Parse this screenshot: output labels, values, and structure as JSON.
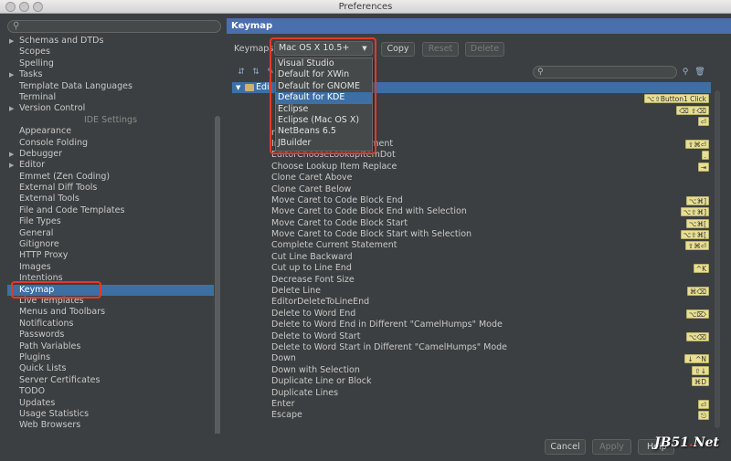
{
  "window": {
    "title": "Preferences"
  },
  "left": {
    "search_placeholder": "",
    "items": [
      {
        "label": "Schemas and DTDs",
        "expandable": true
      },
      {
        "label": "Scopes",
        "expandable": false
      },
      {
        "label": "Spelling",
        "expandable": false
      },
      {
        "label": "Tasks",
        "expandable": true
      },
      {
        "label": "Template Data Languages",
        "expandable": false
      },
      {
        "label": "Terminal",
        "expandable": false
      },
      {
        "label": "Version Control",
        "expandable": true
      }
    ],
    "section_label": "IDE Settings",
    "ide_items": [
      {
        "label": "Appearance",
        "expandable": false
      },
      {
        "label": "Console Folding",
        "expandable": false
      },
      {
        "label": "Debugger",
        "expandable": true
      },
      {
        "label": "Editor",
        "expandable": true
      },
      {
        "label": "Emmet (Zen Coding)",
        "expandable": false
      },
      {
        "label": "External Diff Tools",
        "expandable": false
      },
      {
        "label": "External Tools",
        "expandable": false
      },
      {
        "label": "File and Code Templates",
        "expandable": false
      },
      {
        "label": "File Types",
        "expandable": false
      },
      {
        "label": "General",
        "expandable": false
      },
      {
        "label": "Gitignore",
        "expandable": false
      },
      {
        "label": "HTTP Proxy",
        "expandable": false
      },
      {
        "label": "Images",
        "expandable": false
      },
      {
        "label": "Intentions",
        "expandable": false
      },
      {
        "label": "Keymap",
        "expandable": false,
        "selected": true
      },
      {
        "label": "Live Templates",
        "expandable": false
      },
      {
        "label": "Menus and Toolbars",
        "expandable": false
      },
      {
        "label": "Notifications",
        "expandable": false
      },
      {
        "label": "Passwords",
        "expandable": false
      },
      {
        "label": "Path Variables",
        "expandable": false
      },
      {
        "label": "Plugins",
        "expandable": false
      },
      {
        "label": "Quick Lists",
        "expandable": false
      },
      {
        "label": "Server Certificates",
        "expandable": false
      },
      {
        "label": "TODO",
        "expandable": false
      },
      {
        "label": "Updates",
        "expandable": false
      },
      {
        "label": "Usage Statistics",
        "expandable": false
      },
      {
        "label": "Web Browsers",
        "expandable": false
      }
    ]
  },
  "right": {
    "header": "Keymap",
    "keymaps_label": "Keymaps",
    "selected_keymap": "Mac OS X 10.5+",
    "copy_label": "Copy",
    "reset_label": "Reset",
    "delete_label": "Delete",
    "filter_placeholder": "",
    "keymap_options": [
      "Visual Studio",
      "Default for XWin",
      "Default for GNOME",
      "Default for KDE",
      "Eclipse",
      "Eclipse (Mac OS X)",
      "NetBeans 6.5",
      "JBuilder"
    ],
    "active_option": "Default for KDE",
    "editor_root": "Edi",
    "actions": [
      {
        "label": "",
        "shortcut": "⌥⇧Button1 Click"
      },
      {
        "label": "",
        "shortcut": "⌫ ⇧⌫"
      },
      {
        "label": "",
        "shortcut": "⏎"
      },
      {
        "label": "mAlways",
        "shortcut": ""
      },
      {
        "label": "Invoke Complete Statement",
        "shortcut": "⇧⌘⏎"
      },
      {
        "label": "EditorChooseLookupItemDot",
        "shortcut": "."
      },
      {
        "label": "Choose Lookup Item Replace",
        "shortcut": "⇥"
      },
      {
        "label": "Clone Caret Above",
        "shortcut": ""
      },
      {
        "label": "Clone Caret Below",
        "shortcut": ""
      },
      {
        "label": "Move Caret to Code Block End",
        "shortcut": "⌥⌘]"
      },
      {
        "label": "Move Caret to Code Block End with Selection",
        "shortcut": "⌥⇧⌘]"
      },
      {
        "label": "Move Caret to Code Block Start",
        "shortcut": "⌥⌘["
      },
      {
        "label": "Move Caret to Code Block Start with Selection",
        "shortcut": "⌥⇧⌘["
      },
      {
        "label": "Complete Current Statement",
        "shortcut": "⇧⌘⏎"
      },
      {
        "label": "Cut Line Backward",
        "shortcut": ""
      },
      {
        "label": "Cut up to Line End",
        "shortcut": "^K"
      },
      {
        "label": "Decrease Font Size",
        "shortcut": ""
      },
      {
        "label": "Delete Line",
        "shortcut": "⌘⌫"
      },
      {
        "label": "EditorDeleteToLineEnd",
        "shortcut": ""
      },
      {
        "label": "Delete to Word End",
        "shortcut": "⌥⌦"
      },
      {
        "label": "Delete to Word End in Different \"CamelHumps\" Mode",
        "shortcut": ""
      },
      {
        "label": "Delete to Word Start",
        "shortcut": "⌥⌫"
      },
      {
        "label": "Delete to Word Start in Different \"CamelHumps\" Mode",
        "shortcut": ""
      },
      {
        "label": "Down",
        "shortcut": "↓ ^N"
      },
      {
        "label": "Down with Selection",
        "shortcut": "⇧↓"
      },
      {
        "label": "Duplicate Line or Block",
        "shortcut": "⌘D"
      },
      {
        "label": "Duplicate Lines",
        "shortcut": ""
      },
      {
        "label": "Enter",
        "shortcut": "⏎"
      },
      {
        "label": "Escape",
        "shortcut": "⎋"
      }
    ]
  },
  "footer": {
    "cancel_label": "Cancel",
    "apply_label": "Apply",
    "help_label": "Help"
  },
  "watermark": {
    "text": "JB51",
    "dot": ".",
    "suffix": "Net"
  },
  "colors": {
    "selection": "#3d6fa4",
    "header": "#4b6eaf",
    "highlight": "#e23a2a",
    "shortcut_bg": "#e8df93"
  }
}
